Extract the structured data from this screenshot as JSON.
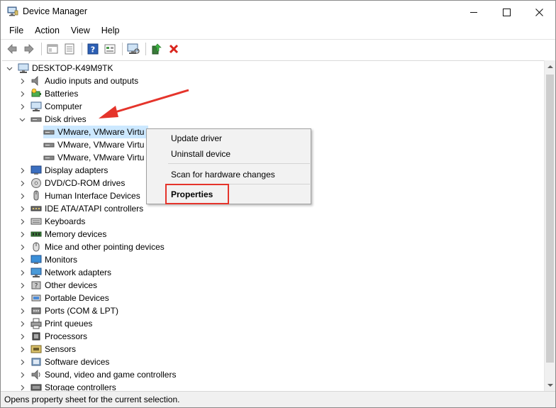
{
  "window": {
    "title": "Device Manager",
    "controls": {
      "minimize": "—",
      "maximize": "☐",
      "close": "✕"
    }
  },
  "menubar": [
    "File",
    "Action",
    "View",
    "Help"
  ],
  "toolbar": {
    "icons": [
      "back-arrow-icon",
      "forward-arrow-icon",
      "properties-panel-icon",
      "list-view-icon",
      "help-icon",
      "resources-view-icon",
      "scan-hardware-icon",
      "update-driver-icon",
      "uninstall-icon"
    ]
  },
  "tree": {
    "root": "DESKTOP-K49M9TK",
    "categories": [
      {
        "label": "Audio inputs and outputs",
        "expanded": false
      },
      {
        "label": "Batteries",
        "expanded": false
      },
      {
        "label": "Computer",
        "expanded": false
      },
      {
        "label": "Disk drives",
        "expanded": true,
        "children": [
          "VMware, VMware Virtu",
          "VMware, VMware Virtu",
          "VMware, VMware Virtu"
        ]
      },
      {
        "label": "Display adapters",
        "expanded": false
      },
      {
        "label": "DVD/CD-ROM drives",
        "expanded": false
      },
      {
        "label": "Human Interface Devices",
        "expanded": false
      },
      {
        "label": "IDE ATA/ATAPI controllers",
        "expanded": false
      },
      {
        "label": "Keyboards",
        "expanded": false
      },
      {
        "label": "Memory devices",
        "expanded": false
      },
      {
        "label": "Mice and other pointing devices",
        "expanded": false
      },
      {
        "label": "Monitors",
        "expanded": false
      },
      {
        "label": "Network adapters",
        "expanded": false
      },
      {
        "label": "Other devices",
        "expanded": false
      },
      {
        "label": "Portable Devices",
        "expanded": false
      },
      {
        "label": "Ports (COM & LPT)",
        "expanded": false
      },
      {
        "label": "Print queues",
        "expanded": false
      },
      {
        "label": "Processors",
        "expanded": false
      },
      {
        "label": "Sensors",
        "expanded": false
      },
      {
        "label": "Software devices",
        "expanded": false
      },
      {
        "label": "Sound, video and game controllers",
        "expanded": false
      },
      {
        "label": "Storage controllers",
        "expanded": false
      }
    ]
  },
  "context_menu": {
    "items": [
      "Update driver",
      "Uninstall device",
      "Scan for hardware changes",
      "Properties"
    ],
    "highlighted": "Properties"
  },
  "statusbar": {
    "text": "Opens property sheet for the current selection."
  },
  "colors": {
    "selection": "#cce8ff",
    "annotation_red": "#e5342b",
    "menu_bg": "#f2f2f2"
  }
}
